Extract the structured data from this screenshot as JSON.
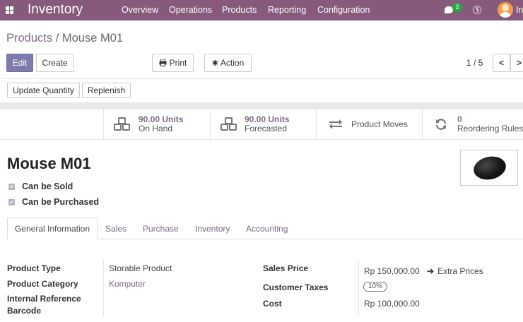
{
  "navbar": {
    "app_name": "Inventory",
    "menu": [
      "Overview",
      "Operations",
      "Products",
      "Reporting",
      "Configuration"
    ],
    "chat_count": "2",
    "user_initial": "In",
    "color": "#875a7b"
  },
  "breadcrumb": {
    "parent": "Products",
    "separator": " / ",
    "current": "Mouse M01"
  },
  "toolbar": {
    "edit": "Edit",
    "create": "Create",
    "print": "Print",
    "action": "Action",
    "pager": "1 / 5",
    "prev": "<",
    "next": ">"
  },
  "header_buttons": {
    "update_quantity": "Update Quantity",
    "replenish": "Replenish"
  },
  "smart_buttons": {
    "on_hand": {
      "value": "90.00 Units",
      "label": "On Hand",
      "icon": "cubes-icon"
    },
    "forecasted": {
      "value": "90.00 Units",
      "label": "Forecasted",
      "icon": "cubes-icon"
    },
    "moves": {
      "label": "Product Moves",
      "icon": "exchange-icon"
    },
    "reordering": {
      "value": "0",
      "label": "Reordering Rules",
      "icon": "refresh-icon"
    }
  },
  "product": {
    "name": "Mouse M01",
    "can_be_sold": "Can be Sold",
    "can_be_purchased": "Can be Purchased"
  },
  "tabs": [
    "General Information",
    "Sales",
    "Purchase",
    "Inventory",
    "Accounting"
  ],
  "fields": {
    "product_type_label": "Product Type",
    "product_type": "Storable Product",
    "product_category_label": "Product Category",
    "product_category": "Komputer",
    "internal_reference_label": "Internal Reference",
    "barcode_label": "Barcode",
    "sales_price_label": "Sales Price",
    "sales_price": "Rp 150,000.00",
    "extra_prices": "Extra Prices",
    "customer_taxes_label": "Customer Taxes",
    "customer_taxes": "10%",
    "cost_label": "Cost",
    "cost": "Rp 100,000.00"
  }
}
